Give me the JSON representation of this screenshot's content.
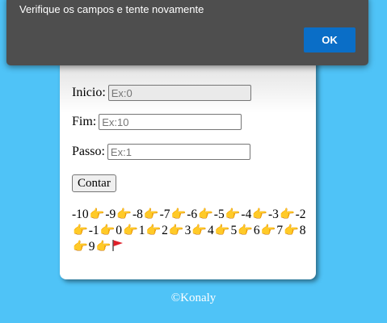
{
  "dialog": {
    "message": "Verifique os campos e tente novamente",
    "ok_label": "OK"
  },
  "form": {
    "inicio_label": "Inicio:",
    "inicio_placeholder": "Ex:0",
    "fim_label": "Fim:",
    "fim_placeholder": "Ex:10",
    "passo_label": "Passo:",
    "passo_placeholder": "Ex:1",
    "button_label": "Contar"
  },
  "result": {
    "numbers": [
      "-10",
      "-9",
      "-8",
      "-7",
      "-6",
      "-5",
      "-4",
      "-3",
      "-2",
      "-1",
      "0",
      "1",
      "2",
      "3",
      "4",
      "5",
      "6",
      "7",
      "8",
      "9"
    ],
    "separator_icon": "pointing-hand-icon",
    "end_icon": "red-flag-icon"
  },
  "footer": {
    "text": "©Konaly"
  },
  "colors": {
    "background": "#4fc3f7",
    "dialog_bg": "#4e4e4e",
    "ok_button": "#0a6ec7"
  }
}
